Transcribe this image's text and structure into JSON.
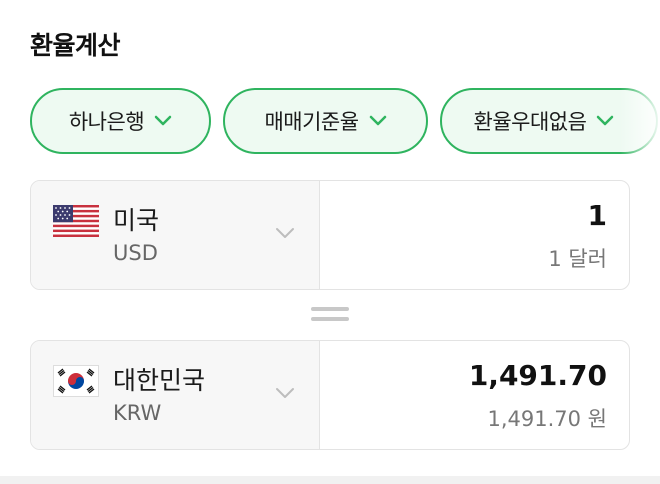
{
  "title": "환율계산",
  "filters": [
    {
      "label": "하나은행"
    },
    {
      "label": "매매기준율"
    },
    {
      "label": "환율우대없음"
    }
  ],
  "from": {
    "country": "미국",
    "code": "USD",
    "amount": "1",
    "amount_text": "1 달러"
  },
  "to": {
    "country": "대한민국",
    "code": "KRW",
    "amount": "1,491.70",
    "amount_text": "1,491.70 원"
  },
  "colors": {
    "accent": "#2fb45f",
    "pill_bg": "#eefaf2"
  },
  "icons": {
    "dropdown": "chevron-down-icon",
    "from_flag": "us-flag-icon",
    "to_flag": "kr-flag-icon",
    "separator": "equals-icon"
  }
}
